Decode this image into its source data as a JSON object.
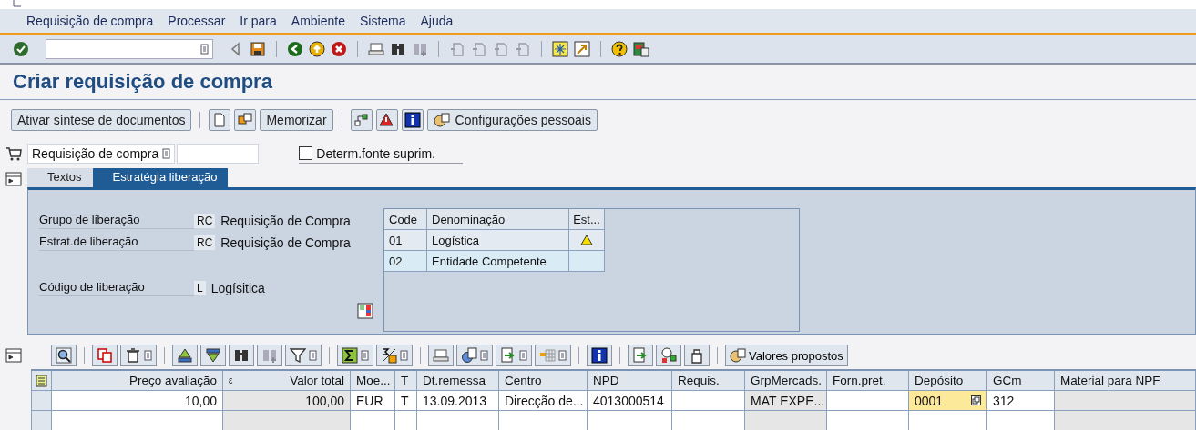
{
  "menu": [
    {
      "label": "Requisição de compra"
    },
    {
      "label": "Processar"
    },
    {
      "label": "Ir para"
    },
    {
      "label": "Ambiente"
    },
    {
      "label": "Sistema"
    },
    {
      "label": "Ajuda"
    }
  ],
  "title": "Criar requisição de compra",
  "app_toolbar": {
    "buttons": [
      "Ativar síntese de documentos",
      "Memorizar",
      "Configurações pessoais"
    ]
  },
  "header": {
    "doc_type": "Requisição de compra",
    "checkbox": {
      "label": "Determ.fonte suprim.",
      "checked": false
    }
  },
  "tabs": [
    {
      "label": "Textos",
      "selected": false
    },
    {
      "label": "Estratégia liberação",
      "selected": true
    }
  ],
  "release": {
    "fields": [
      {
        "label": "Grupo de liberação",
        "code": "RC",
        "text": "Requisição de Compra"
      },
      {
        "label": "Estrat.de liberação",
        "code": "RC",
        "text": "Requisição de Compra"
      },
      {
        "label": "Código de liberação",
        "code": "L",
        "text": "Logísitica"
      }
    ],
    "table": {
      "columns": [
        "Code",
        "Denominação",
        "Est..."
      ],
      "rows": [
        {
          "code": "01",
          "name": "Logística",
          "warning": true
        },
        {
          "code": "02",
          "name": "Entidade Competente",
          "warning": false
        }
      ]
    }
  },
  "grid": {
    "toolbar_button": "Valores propostos",
    "columns": [
      {
        "label": "Preço avaliação",
        "kind": "amount"
      },
      {
        "label": "Valor total",
        "kind": "amount-readonly",
        "mark": "ε"
      },
      {
        "label": "Moe...",
        "kind": "text"
      },
      {
        "label": "T",
        "kind": "text"
      },
      {
        "label": "Dt.remessa",
        "kind": "text"
      },
      {
        "label": "Centro",
        "kind": "text"
      },
      {
        "label": "NPD",
        "kind": "text"
      },
      {
        "label": "Requis.",
        "kind": "text"
      },
      {
        "label": "GrpMercads.",
        "kind": "readonly"
      },
      {
        "label": "Forn.pret.",
        "kind": "text"
      },
      {
        "label": "Depósito",
        "kind": "focused"
      },
      {
        "label": "GCm",
        "kind": "text"
      },
      {
        "label": "Material para NPF",
        "kind": "readonly"
      }
    ],
    "rows": [
      {
        "cells": [
          "10,00",
          "100,00",
          "EUR",
          "T",
          "13.09.2013",
          "Direcção de...",
          "4013000514",
          "",
          "MAT EXPE...",
          "",
          "0001",
          "312",
          ""
        ]
      }
    ]
  }
}
